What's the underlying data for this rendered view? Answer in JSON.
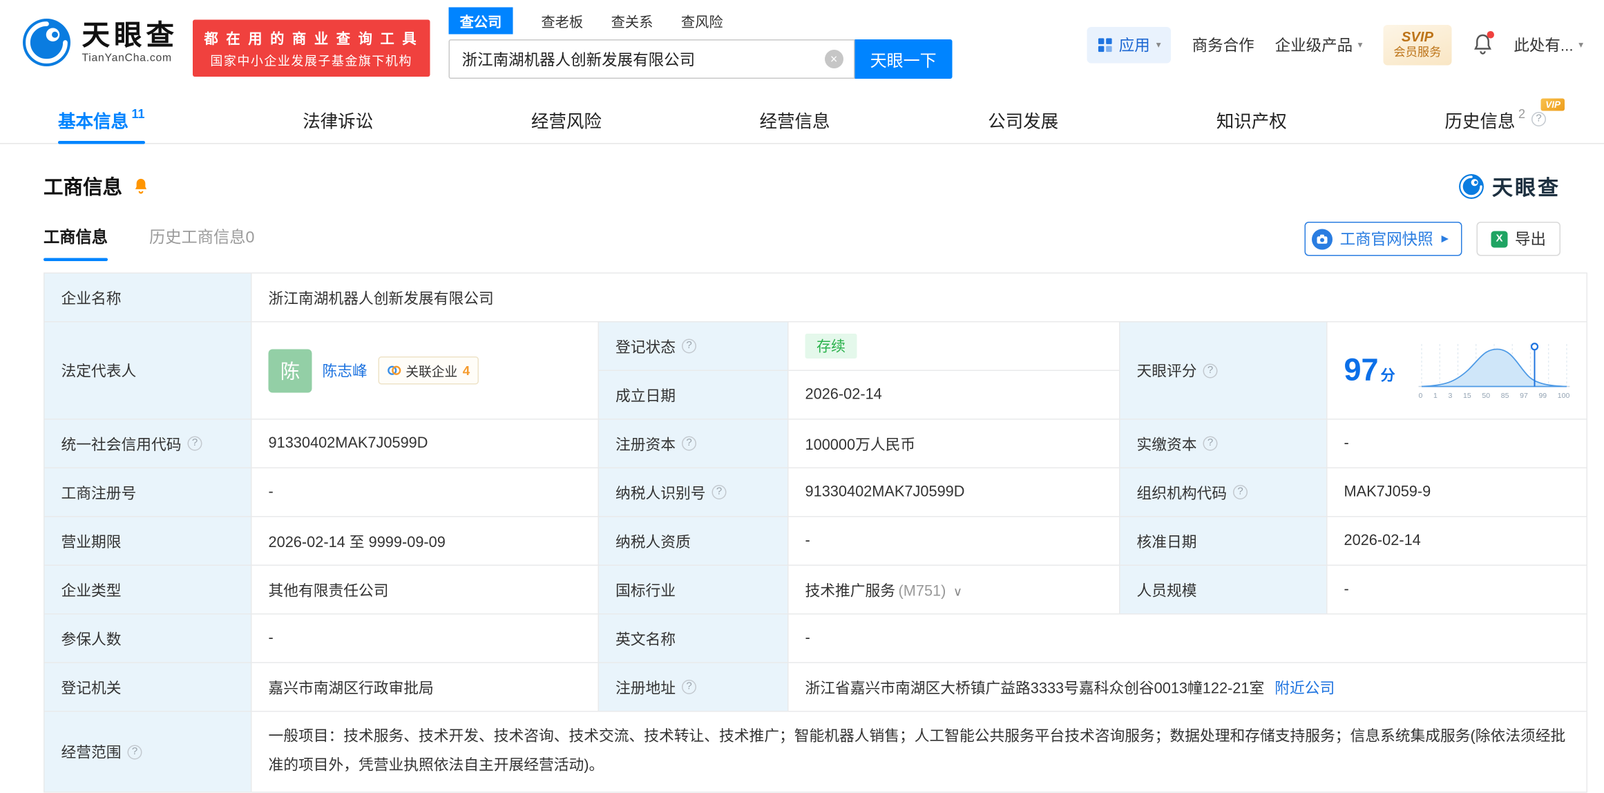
{
  "colors": {
    "brand_blue": "#0084ff",
    "promo_red": "#f0413e",
    "status_green": "#2bb24c",
    "status_green_bg": "#e4f8eb",
    "label_cell_bg": "#e9f4fb",
    "avatar_green": "#93cfa6",
    "vip_gold": "#ee9e1d",
    "score_blue": "#0b6fe8"
  },
  "icons": {
    "help": "?",
    "caret_down": "▾",
    "caret_expand": "∨",
    "clear": "×",
    "play": "▶",
    "excel": "X"
  },
  "header": {
    "logo": {
      "title": "天眼查",
      "subtitle": "TianYanCha.com"
    },
    "promo": {
      "line1": "都 在 用 的 商 业 查 询 工 具",
      "line2": "国家中小企业发展子基金旗下机构"
    },
    "search": {
      "tabs": [
        {
          "label": "查公司",
          "active": true
        },
        {
          "label": "查老板",
          "active": false
        },
        {
          "label": "查关系",
          "active": false
        },
        {
          "label": "查风险",
          "active": false
        }
      ],
      "value": "浙江南湖机器人创新发展有限公司",
      "button": "天眼一下"
    },
    "nav": {
      "apps": "应用",
      "cooperation": "商务合作",
      "enterprise": "企业级产品",
      "svip_title": "SVIP",
      "svip_subtitle": "会员服务",
      "user": "此处有..."
    }
  },
  "tabs": [
    {
      "label": "基本信息",
      "count": "11"
    },
    {
      "label": "法律诉讼",
      "count": ""
    },
    {
      "label": "经营风险",
      "count": ""
    },
    {
      "label": "经营信息",
      "count": ""
    },
    {
      "label": "公司发展",
      "count": ""
    },
    {
      "label": "知识产权",
      "count": ""
    },
    {
      "label": "历史信息",
      "count": "2",
      "vip": "VIP"
    }
  ],
  "section": {
    "title": "工商信息",
    "brand": "天眼查"
  },
  "subtabs": {
    "current": "工商信息",
    "history": "历史工商信息",
    "history_count": "0",
    "snapshot_button": "工商官网快照",
    "export_button": "导出"
  },
  "company": {
    "name_label": "企业名称",
    "name": "浙江南湖机器人创新发展有限公司",
    "legal_label": "法定代表人",
    "legal_avatar": "陈",
    "legal_name": "陈志峰",
    "related_label": "关联企业",
    "related_count": "4",
    "status_label": "登记状态",
    "status": "存续",
    "established_label": "成立日期",
    "established": "2026-02-14",
    "score_label": "天眼评分",
    "credit_label": "统一社会信用代码",
    "credit": "91330402MAK7J0599D",
    "capital_label": "注册资本",
    "capital": "100000万人民币",
    "paid_label": "实缴资本",
    "paid": "-",
    "regno_label": "工商注册号",
    "regno": "-",
    "tax_label": "纳税人识别号",
    "tax": "91330402MAK7J0599D",
    "org_label": "组织机构代码",
    "org": "MAK7J059-9",
    "term_label": "营业期限",
    "term": "2026-02-14 至 9999-09-09",
    "taxq_label": "纳税人资质",
    "taxq": "-",
    "approve_label": "核准日期",
    "approve": "2026-02-14",
    "type_label": "企业类型",
    "type": "其他有限责任公司",
    "industry_label": "国标行业",
    "industry": "技术推广服务",
    "industry_code": "(M751)",
    "staff_label": "人员规模",
    "staff": "-",
    "insured_label": "参保人数",
    "insured": "-",
    "en_label": "英文名称",
    "en": "-",
    "registry_label": "登记机关",
    "registry": "嘉兴市南湖区行政审批局",
    "addr_label": "注册地址",
    "addr": "浙江省嘉兴市南湖区大桥镇广益路3333号嘉科众创谷0013幢122-21室",
    "nearby": "附近公司",
    "scope_label": "经营范围",
    "scope": "一般项目：技术服务、技术开发、技术咨询、技术交流、技术转让、技术推广；智能机器人销售；人工智能公共服务平台技术咨询服务；数据处理和存储支持服务；信息系统集成服务(除依法须经批准的项目外，凭营业执照依法自主开展经营活动)。"
  },
  "score_chart": {
    "type": "area",
    "score": "97",
    "unit": "分",
    "x_ticks": [
      "0",
      "1",
      "3",
      "15",
      "50",
      "85",
      "97",
      "99",
      "100"
    ],
    "marker_value": 97
  }
}
